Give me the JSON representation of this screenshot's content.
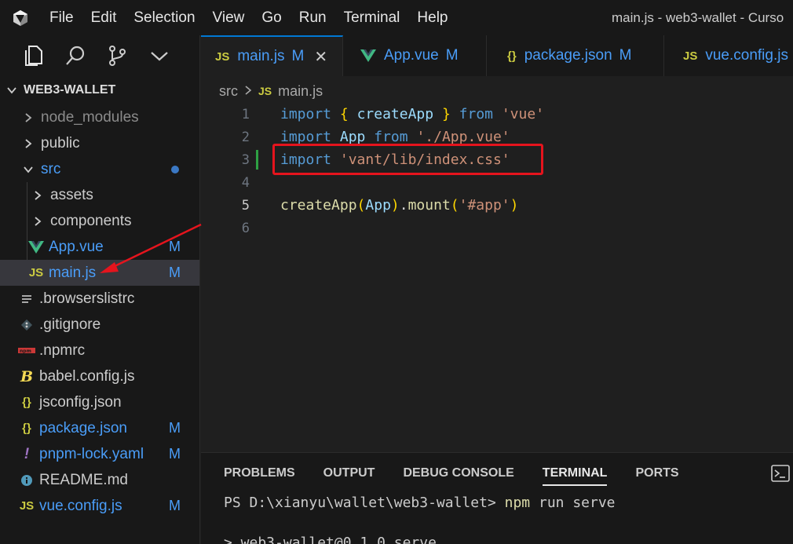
{
  "titlebar": {
    "logo_icon": "cursor-logo-icon",
    "menu": [
      "File",
      "Edit",
      "Selection",
      "View",
      "Go",
      "Run",
      "Terminal",
      "Help"
    ],
    "window_title": "main.js - web3-wallet - Curso"
  },
  "activity": {
    "icons": [
      "explorer-icon",
      "search-icon",
      "source-control-icon",
      "chevron-down-icon"
    ]
  },
  "explorer": {
    "title": "WEB3-WALLET",
    "items": [
      {
        "label": "node_modules",
        "icon": "chevron-right-icon",
        "status": "",
        "depth": 1
      },
      {
        "label": "public",
        "icon": "chevron-right-icon",
        "status": "",
        "depth": 1
      },
      {
        "label": "src",
        "icon": "chevron-down-icon",
        "status": "modified-dot",
        "depth": 1
      },
      {
        "label": "assets",
        "icon": "chevron-right-icon",
        "status": "",
        "depth": 2
      },
      {
        "label": "components",
        "icon": "chevron-right-icon",
        "status": "",
        "depth": 2
      },
      {
        "label": "App.vue",
        "icon": "vue-icon",
        "status": "M",
        "depth": 2
      },
      {
        "label": "main.js",
        "icon": "js-icon",
        "status": "M",
        "depth": 2
      },
      {
        "label": ".browserslistrc",
        "icon": "lines-icon",
        "status": "",
        "depth": 1
      },
      {
        "label": ".gitignore",
        "icon": "git-icon",
        "status": "",
        "depth": 1
      },
      {
        "label": ".npmrc",
        "icon": "npm-icon",
        "status": "",
        "depth": 1
      },
      {
        "label": "babel.config.js",
        "icon": "babel-icon",
        "status": "",
        "depth": 1
      },
      {
        "label": "jsconfig.json",
        "icon": "json-icon",
        "status": "",
        "depth": 1
      },
      {
        "label": "package.json",
        "icon": "json-icon",
        "status": "M",
        "depth": 1
      },
      {
        "label": "pnpm-lock.yaml",
        "icon": "yaml-icon",
        "status": "M",
        "depth": 1
      },
      {
        "label": "README.md",
        "icon": "info-icon",
        "status": "",
        "depth": 1
      },
      {
        "label": "vue.config.js",
        "icon": "js-icon",
        "status": "M",
        "depth": 1
      }
    ]
  },
  "tabs": [
    {
      "label": "main.js",
      "icon": "js-icon",
      "status": "M",
      "active": true
    },
    {
      "label": "App.vue",
      "icon": "vue-icon",
      "status": "M",
      "active": false
    },
    {
      "label": "package.json",
      "icon": "json-icon",
      "status": "M",
      "active": false
    },
    {
      "label": "vue.config.js",
      "icon": "js-icon",
      "status": "",
      "active": false
    }
  ],
  "breadcrumb": {
    "folder": "src",
    "file": "main.js"
  },
  "editor": {
    "line_numbers": [
      "1",
      "2",
      "3",
      "4",
      "5",
      "6"
    ],
    "active_line": "5",
    "highlighted_line": "3",
    "lines": [
      [
        [
          "kw",
          "import"
        ],
        [
          "pl",
          " "
        ],
        [
          "br1",
          "{"
        ],
        [
          "pl",
          " "
        ],
        [
          "var",
          "createApp"
        ],
        [
          "pl",
          " "
        ],
        [
          "br1",
          "}"
        ],
        [
          "pl",
          " "
        ],
        [
          "kw",
          "from"
        ],
        [
          "pl",
          " "
        ],
        [
          "str",
          "'vue'"
        ]
      ],
      [
        [
          "kw",
          "import"
        ],
        [
          "pl",
          " "
        ],
        [
          "var",
          "App"
        ],
        [
          "pl",
          " "
        ],
        [
          "kw",
          "from"
        ],
        [
          "pl",
          " "
        ],
        [
          "str",
          "'./App.vue'"
        ]
      ],
      [
        [
          "kw",
          "import"
        ],
        [
          "pl",
          " "
        ],
        [
          "str",
          "'vant/lib/index.css'"
        ]
      ],
      [],
      [
        [
          "fn",
          "createApp"
        ],
        [
          "br1",
          "("
        ],
        [
          "var",
          "App"
        ],
        [
          "br1",
          ")"
        ],
        [
          "pl",
          "."
        ],
        [
          "fn",
          "mount"
        ],
        [
          "br1",
          "("
        ],
        [
          "str",
          "'#app'"
        ],
        [
          "br1",
          ")"
        ]
      ],
      []
    ]
  },
  "panel": {
    "tabs": [
      "PROBLEMS",
      "OUTPUT",
      "DEBUG CONSOLE",
      "TERMINAL",
      "PORTS"
    ],
    "active_tab": "TERMINAL",
    "terminal_prompt": "PS D:\\xianyu\\wallet\\web3-wallet> ",
    "terminal_cmd": "npm",
    "terminal_args": " run serve",
    "terminal_output": "> web3-wallet@0.1.0 serve"
  },
  "colors": {
    "accent": "#0078d4",
    "modified": "#4a9df8",
    "annotation_red": "#e5141d"
  }
}
